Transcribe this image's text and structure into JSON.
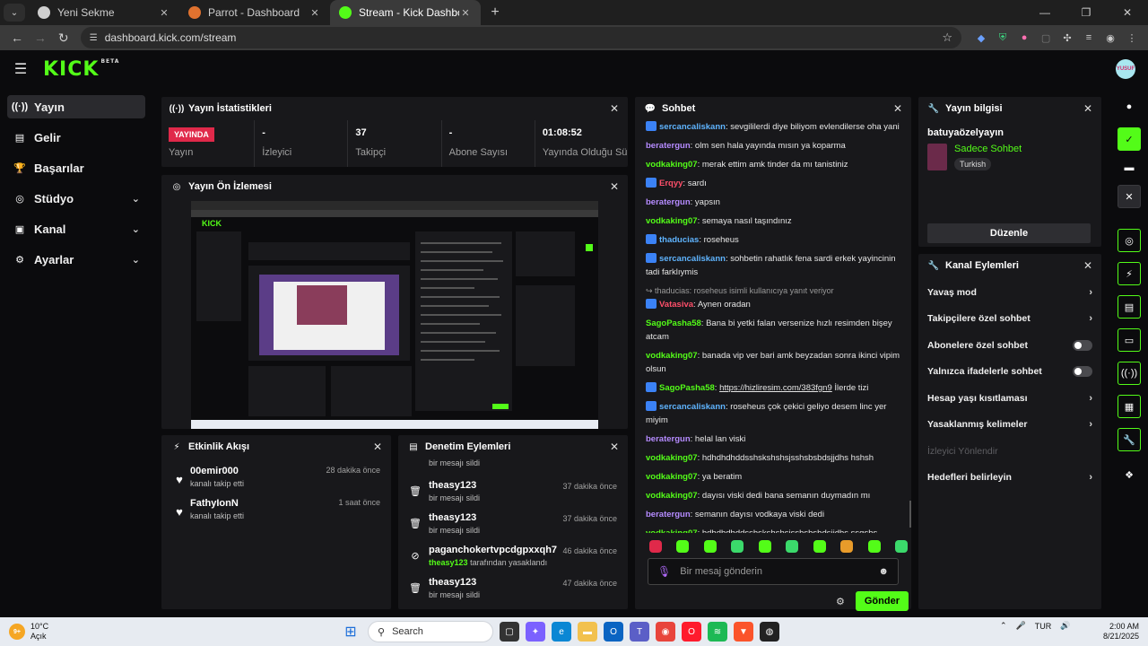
{
  "browser": {
    "tabs": [
      {
        "title": "Yeni Sekme",
        "favicon_color": "#cfcfcf",
        "active": false
      },
      {
        "title": "Parrot - Dashboard",
        "favicon_color": "#e0722f",
        "active": false
      },
      {
        "title": "Stream - Kick Dashboard",
        "favicon_color": "#53fc18",
        "active": true
      }
    ],
    "url": "dashboard.kick.com/stream"
  },
  "header": {
    "logo": "KICK",
    "beta": "BETA",
    "avatar_text": "YUSUF"
  },
  "sidebar": {
    "items": [
      {
        "label": "Yayın",
        "icon": "broadcast-icon",
        "glyph": "((·))",
        "expandable": false,
        "active": true
      },
      {
        "label": "Gelir",
        "icon": "revenue-icon",
        "glyph": "▤",
        "expandable": false,
        "active": false
      },
      {
        "label": "Başarılar",
        "icon": "trophy-icon",
        "glyph": "🏆",
        "expandable": false,
        "active": false
      },
      {
        "label": "Stüdyo",
        "icon": "studio-icon",
        "glyph": "◎",
        "expandable": true,
        "active": false
      },
      {
        "label": "Kanal",
        "icon": "channel-icon",
        "glyph": "▣",
        "expandable": true,
        "active": false
      },
      {
        "label": "Ayarlar",
        "icon": "settings-icon",
        "glyph": "⚙",
        "expandable": true,
        "active": false
      }
    ]
  },
  "stats": {
    "title": "Yayın İstatistikleri",
    "items": [
      {
        "value": "YAYINDA",
        "label": "Yayın",
        "badge": true
      },
      {
        "value": "-",
        "label": "İzleyici",
        "badge": false
      },
      {
        "value": "37",
        "label": "Takipçi",
        "badge": false
      },
      {
        "value": "-",
        "label": "Abone Sayısı",
        "badge": false
      },
      {
        "value": "01:08:52",
        "label": "Yayında Olduğu Süre",
        "badge": false
      }
    ]
  },
  "preview": {
    "title": "Yayın Ön İzlemesi",
    "logo": "KICK"
  },
  "activity": {
    "title": "Etkinlik Akışı",
    "items": [
      {
        "name": "00emir000",
        "desc": "kanalı takip etti",
        "time": "28 dakika önce"
      },
      {
        "name": "FathyIonN",
        "desc": "kanalı takip etti",
        "time": "1 saat önce"
      }
    ]
  },
  "moderation": {
    "title": "Denetim Eylemleri",
    "top_desc": "bir mesajı sildi",
    "items": [
      {
        "name": "theasy123",
        "desc": "bir mesajı sildi",
        "by": "",
        "time": "37 dakika önce",
        "icon": "trash-icon"
      },
      {
        "name": "theasy123",
        "desc": "bir mesajı sildi",
        "by": "",
        "time": "37 dakika önce",
        "icon": "trash-icon"
      },
      {
        "name": "paganchokertvpcdgpxxqh7",
        "desc": "tarafından yasaklandı",
        "by": "theasy123",
        "time": "46 dakika önce",
        "icon": "ban-icon"
      },
      {
        "name": "theasy123",
        "desc": "bir mesajı sildi",
        "by": "",
        "time": "47 dakika önce",
        "icon": "trash-icon"
      }
    ]
  },
  "chat": {
    "title": "Sohbet",
    "messages": [
      {
        "user": "sercancaliskann",
        "color": "#5fb4ff",
        "badge": true,
        "text": "sevgililerdi diye biliyom evlendilerse oha yani"
      },
      {
        "user": "beratergun",
        "color": "#b58bff",
        "badge": false,
        "text": "olm sen hala yayında mısın ya koparma"
      },
      {
        "user": "vodkaking07",
        "color": "#53fc18",
        "badge": false,
        "text": "merak ettim amk tinder da mı tanistiniz"
      },
      {
        "user": "Erqyy",
        "color": "#ff4f6a",
        "badge": true,
        "text": "sardı"
      },
      {
        "user": "beratergun",
        "color": "#b58bff",
        "badge": false,
        "text": "yapsın"
      },
      {
        "user": "vodkaking07",
        "color": "#53fc18",
        "badge": false,
        "text": "semaya nasıl taşındınız"
      },
      {
        "user": "thaducias",
        "color": "#5fb4ff",
        "badge": true,
        "text": "roseheus"
      },
      {
        "user": "sercancaliskann",
        "color": "#5fb4ff",
        "badge": true,
        "text": "sohbetin rahatlık fena sardi erkek yayincinin tadi farklıymis"
      },
      {
        "user": "Vatasiva",
        "color": "#ff4f6a",
        "badge": true,
        "reply": "thaducias: roseheus isimli kullanıcıya yanıt veriyor",
        "text": "Aynen oradan"
      },
      {
        "user": "SagoPasha58",
        "color": "#53fc18",
        "badge": false,
        "text": "Bana bi yetki falan versenize hızlı resimden bişey atcam"
      },
      {
        "user": "vodkaking07",
        "color": "#53fc18",
        "badge": false,
        "text": "banada vip ver bari amk beyzadan sonra ikinci vipim olsun"
      },
      {
        "user": "SagoPasha58",
        "color": "#53fc18",
        "badge": true,
        "link": "https://hizliresim.com/383fgn9",
        "text": "İlerde tizi"
      },
      {
        "user": "sercancaliskann",
        "color": "#5fb4ff",
        "badge": true,
        "text": "roseheus çok çekici geliyo desem linc yer miyim"
      },
      {
        "user": "beratergun",
        "color": "#b58bff",
        "badge": false,
        "text": "helal lan viski"
      },
      {
        "user": "vodkaking07",
        "color": "#53fc18",
        "badge": false,
        "text": "hdhdhdhddsshskshshsjsshsbsbdsjjdhs hshsh"
      },
      {
        "user": "vodkaking07",
        "color": "#53fc18",
        "badge": false,
        "text": "ya beratim"
      },
      {
        "user": "vodkaking07",
        "color": "#53fc18",
        "badge": false,
        "text": "dayısı viski dedi bana semanın duymadın mı"
      },
      {
        "user": "beratergun",
        "color": "#b58bff",
        "badge": false,
        "text": "semanın dayısı vodkaya viski dedi"
      },
      {
        "user": "vodkaking07",
        "color": "#53fc18",
        "badge": false,
        "text": "hdhdhdhddsshskshshsjsshsbsbdsjjdhs ssgshs"
      }
    ],
    "placeholder": "Bir mesaj gönderin",
    "send_label": "Gönder"
  },
  "stream_info": {
    "title": "Yayın bilgisi",
    "stream_title": "batuyaözelyayın",
    "category": "Sadece Sohbet",
    "tag": "Turkish",
    "edit_label": "Düzenle"
  },
  "channel_actions": {
    "title": "Kanal Eylemleri",
    "items": [
      {
        "label": "Yavaş mod",
        "kind": "chevron"
      },
      {
        "label": "Takipçilere özel sohbet",
        "kind": "chevron"
      },
      {
        "label": "Abonelere özel sohbet",
        "kind": "toggle"
      },
      {
        "label": "Yalnızca ifadelerle sohbet",
        "kind": "toggle"
      },
      {
        "label": "Hesap yaşı kısıtlaması",
        "kind": "chevron"
      },
      {
        "label": "Yasaklanmış kelimeler",
        "kind": "chevron"
      },
      {
        "label": "İzleyici Yönlendir",
        "kind": "disabled"
      },
      {
        "label": "Hedefleri belirleyin",
        "kind": "chevron"
      }
    ]
  },
  "taskbar": {
    "weather_badge": "9+",
    "temp": "10°C",
    "condition": "Açık",
    "search": "Search",
    "lang": "TUR",
    "time": "2:00 AM",
    "date": "8/21/2025"
  }
}
